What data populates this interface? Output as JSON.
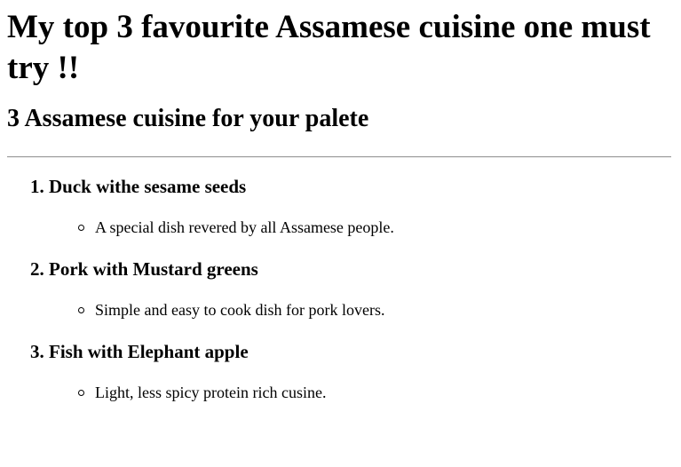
{
  "heading": "My top 3 favourite Assamese cuisine one must try !!",
  "subheading": "3 Assamese cuisine for your palete",
  "dishes": [
    {
      "number": "1.",
      "name": "Duck withe sesame seeds",
      "description": "A special dish revered by all Assamese people."
    },
    {
      "number": "2.",
      "name": "Pork with Mustard greens",
      "description": "Simple and easy to cook dish for pork lovers."
    },
    {
      "number": "3.",
      "name": "Fish with Elephant apple",
      "description": "Light, less spicy protein rich cusine."
    }
  ]
}
